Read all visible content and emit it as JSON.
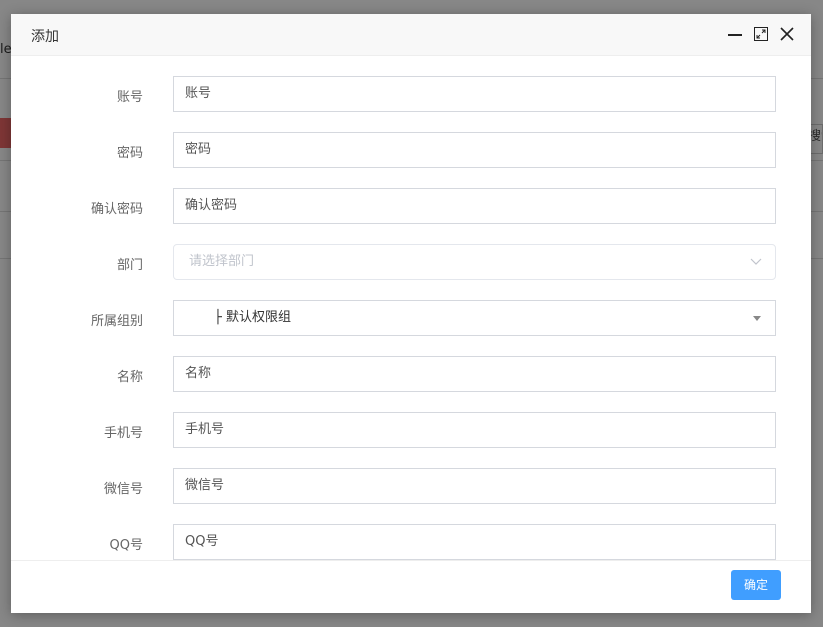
{
  "background": {
    "left_text": "le",
    "right_text": "搜索"
  },
  "dialog": {
    "title": "添加",
    "fields": [
      {
        "label": "账号",
        "value": "账号"
      },
      {
        "label": "密码",
        "value": "密码"
      },
      {
        "label": "确认密码",
        "value": "确认密码"
      },
      {
        "label": "部门",
        "placeholder": "请选择部门"
      },
      {
        "label": "所属组别",
        "value": "├ 默认权限组"
      },
      {
        "label": "名称",
        "value": "名称"
      },
      {
        "label": "手机号",
        "value": "手机号"
      },
      {
        "label": "微信号",
        "value": "微信号"
      },
      {
        "label": "QQ号",
        "value": "QQ号"
      }
    ],
    "confirm_label": "确定",
    "primary_color": "#409eff"
  }
}
